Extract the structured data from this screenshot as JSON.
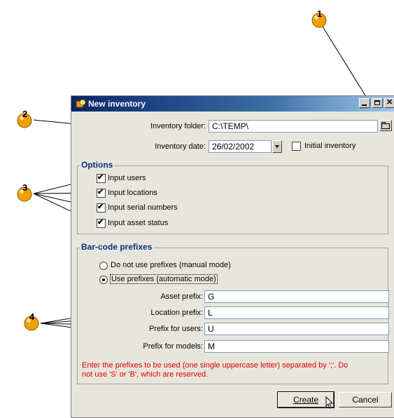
{
  "window": {
    "title": "New inventory",
    "inventory_folder_label": "Inventory folder:",
    "inventory_folder_value": "C:\\TEMP\\",
    "inventory_date_label": "Inventory date:",
    "inventory_date_value": "26/02/2002",
    "initial_inventory_label": "Initial inventory",
    "options_title": "Options",
    "options": [
      {
        "label": "Input users",
        "checked": true
      },
      {
        "label": "Input locations",
        "checked": true
      },
      {
        "label": "Input serial numbers",
        "checked": true
      },
      {
        "label": "Input asset status",
        "checked": true
      }
    ],
    "barcode_title": "Bar-code prefixes",
    "radio_no_prefix": "Do not use prefixes (manual mode)",
    "radio_use_prefix": "Use prefixes (automatic mode)",
    "prefixes": [
      {
        "label": "Asset prefix:",
        "value": "G"
      },
      {
        "label": "Location prefix:",
        "value": "L"
      },
      {
        "label": "Prefix for users:",
        "value": "U"
      },
      {
        "label": "Prefix for models:",
        "value": "M"
      }
    ],
    "hint_line1": "Enter the prefixes to be used (one single uppercase letter) separated by ';'. Do",
    "hint_line2": "not use 'S' or 'B', which are reserved.",
    "create_label": "Create",
    "cancel_label": "Cancel"
  },
  "markers": [
    "1",
    "2",
    "3",
    "4"
  ],
  "colors": {
    "marker": "#f0a000",
    "hint": "#e00000",
    "title_gradient_start": "#0a246a"
  }
}
